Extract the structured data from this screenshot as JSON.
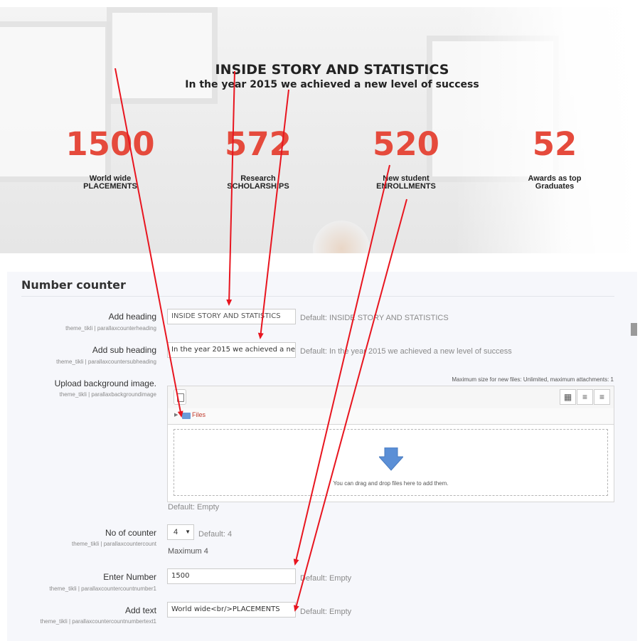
{
  "hero": {
    "title": "INSIDE STORY AND STATISTICS",
    "subtitle": "In the year 2015 we achieved a new level of success",
    "stats": [
      {
        "value": "1500",
        "line1": "World wide",
        "line2": "PLACEMENTS"
      },
      {
        "value": "572",
        "line1": "Research",
        "line2": "SCHOLARSHIPS"
      },
      {
        "value": "520",
        "line1": "New student",
        "line2": "ENROLLMENTS"
      },
      {
        "value": "52",
        "line1": "Awards as top",
        "line2": "Graduates"
      }
    ]
  },
  "colors": {
    "accent": "#e54a3c",
    "annotation": "#e8151f",
    "panel": "#f6f7fb"
  },
  "settings": {
    "section_title": "Number counter",
    "heading": {
      "label": "Add heading",
      "setting": "theme_tikli | parallaxcounterheading",
      "value": "INSIDE STORY AND STATISTICS",
      "default": "Default: INSIDE STORY AND STATISTICS"
    },
    "subheading": {
      "label": "Add sub heading",
      "setting": "theme_tikli | parallaxcountersubheading",
      "value": "In the year 2015 we achieved a ne",
      "default": "Default: In the year 2015 we achieved a new level of success"
    },
    "background": {
      "label": "Upload background image.",
      "setting": "theme_tikli | parallaxbackgroundimage",
      "max_size": "Maximum size for new files: Unlimited, maximum attachments: 1",
      "files_label": "Files",
      "drop_text": "You can drag and drop files here to add them.",
      "default": "Default: Empty",
      "icons": [
        "add-file-icon",
        "grid-view-icon",
        "list-view-icon",
        "tree-view-icon",
        "folder-icon",
        "download-arrow-icon"
      ]
    },
    "count": {
      "label": "No of counter",
      "setting": "theme_tikli | parallaxcountercount",
      "value": "4",
      "default": "Default: 4",
      "max": "Maximum 4"
    },
    "number": {
      "label": "Enter Number",
      "setting": "theme_tikli | parallaxcountercountnumber1",
      "value": "1500",
      "default": "Default: Empty"
    },
    "text": {
      "label": "Add text",
      "setting": "theme_tikli | parallaxcountercountnumbertext1",
      "value": "World wide<br/>PLACEMENTS",
      "default": "Default: Empty"
    }
  }
}
